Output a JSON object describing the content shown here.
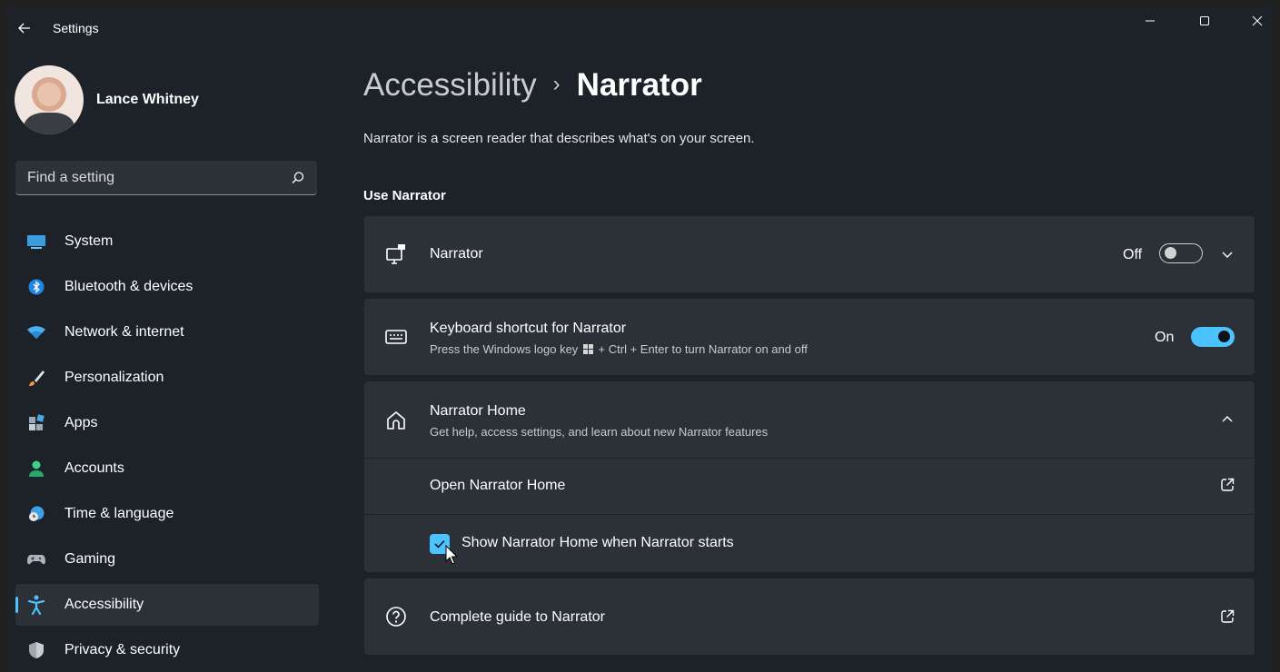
{
  "window": {
    "title": "Settings",
    "controls": [
      "minimize",
      "maximize",
      "close"
    ]
  },
  "profile": {
    "name": "Lance Whitney"
  },
  "search": {
    "placeholder": "Find a setting"
  },
  "sidebar": {
    "items": [
      {
        "label": "System",
        "icon": "monitor-icon",
        "selected": false
      },
      {
        "label": "Bluetooth & devices",
        "icon": "bluetooth-icon",
        "selected": false
      },
      {
        "label": "Network & internet",
        "icon": "wifi-icon",
        "selected": false
      },
      {
        "label": "Personalization",
        "icon": "brush-icon",
        "selected": false
      },
      {
        "label": "Apps",
        "icon": "apps-icon",
        "selected": false
      },
      {
        "label": "Accounts",
        "icon": "person-icon",
        "selected": false
      },
      {
        "label": "Time & language",
        "icon": "globe-clock-icon",
        "selected": false
      },
      {
        "label": "Gaming",
        "icon": "gamepad-icon",
        "selected": false
      },
      {
        "label": "Accessibility",
        "icon": "accessibility-icon",
        "selected": true
      },
      {
        "label": "Privacy & security",
        "icon": "shield-icon",
        "selected": false
      }
    ]
  },
  "breadcrumb": {
    "parent": "Accessibility",
    "separator": "›",
    "current": "Narrator"
  },
  "description": "Narrator is a screen reader that describes what's on your screen.",
  "section": {
    "title": "Use Narrator"
  },
  "cards": {
    "narrator": {
      "title": "Narrator",
      "state": "Off",
      "toggle_on": false
    },
    "shortcut": {
      "title": "Keyboard shortcut for Narrator",
      "subtitle_before": "Press the Windows logo key",
      "subtitle_after": "+ Ctrl + Enter to turn Narrator on and off",
      "state": "On",
      "toggle_on": true
    },
    "home": {
      "title": "Narrator Home",
      "subtitle": "Get help, access settings, and learn about new Narrator features",
      "open_label": "Open Narrator Home",
      "checkbox_label": "Show Narrator Home when Narrator starts",
      "checkbox_checked": true
    },
    "guide": {
      "title": "Complete guide to Narrator"
    }
  },
  "colors": {
    "accent": "#4cc2ff",
    "window_bg": "#1c2228",
    "card_bg": "#2b3137"
  }
}
